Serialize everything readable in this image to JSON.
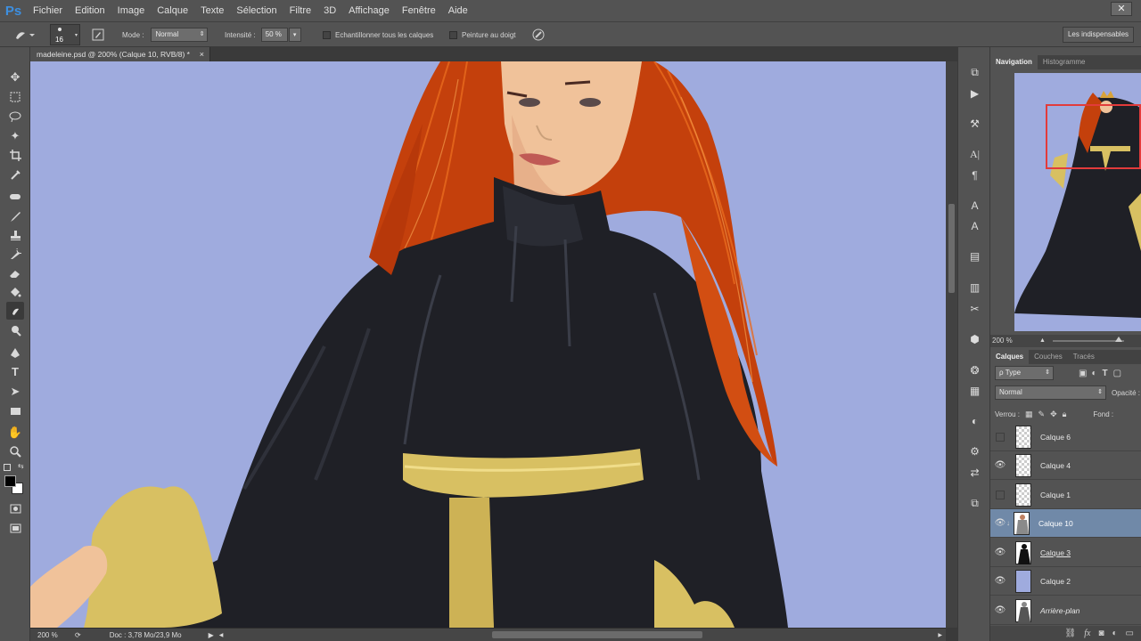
{
  "app": {
    "logo": "Ps",
    "close_glyph": "✕"
  },
  "menu": [
    "Fichier",
    "Edition",
    "Image",
    "Calque",
    "Texte",
    "Sélection",
    "Filtre",
    "3D",
    "Affichage",
    "Fenêtre",
    "Aide"
  ],
  "options": {
    "brush_size": "16",
    "mode_label": "Mode :",
    "mode_value": "Normal",
    "intensity_label": "Intensité :",
    "intensity_value": "50 %",
    "sample_all_label": "Echantillonner tous les calques",
    "finger_paint_label": "Peinture au doigt",
    "workspace": "Les indispensables"
  },
  "document": {
    "tab_title": "madeleine.psd @ 200% (Calque 10, RVB/8) *",
    "tab_close": "×",
    "status_zoom": "200 %",
    "status_doc": "Doc : 3,78 Mo/23,9 Mo"
  },
  "navigator": {
    "tab_active": "Navigation",
    "tab_other": "Histogramme",
    "zoom": "200 %"
  },
  "layers_panel": {
    "tabs": [
      "Calques",
      "Couches",
      "Tracés"
    ],
    "filter": "ρ Type",
    "blend_mode": "Normal",
    "opacity_label": "Opacité :",
    "lock_label": "Verrou :",
    "fill_label": "Fond :",
    "layers": [
      {
        "name": "Calque 6",
        "visible": false,
        "thumb": "checker"
      },
      {
        "name": "Calque 4",
        "visible": true,
        "thumb": "checker"
      },
      {
        "name": "Calque 1",
        "visible": false,
        "thumb": "checker"
      },
      {
        "name": "Calque 10",
        "visible": true,
        "thumb": "figure",
        "selected": true
      },
      {
        "name": "Calque 3",
        "visible": true,
        "thumb": "silhouette"
      },
      {
        "name": "Calque 2",
        "visible": true,
        "thumb": "blue"
      },
      {
        "name": "Arrière-plan",
        "visible": true,
        "thumb": "figure-dark"
      }
    ],
    "footer_icons": [
      "link-icon",
      "fx-icon",
      "mask-icon",
      "adjustment-icon",
      "group-icon"
    ]
  },
  "colors": {
    "canvas_bg": "#9fabde",
    "hair": "#c9430f",
    "dress": "#1f2026",
    "sash": "#d8c062",
    "skin": "#f0c29a",
    "selected_layer": "#7089a8",
    "nav_rect": "#e23b3b"
  }
}
